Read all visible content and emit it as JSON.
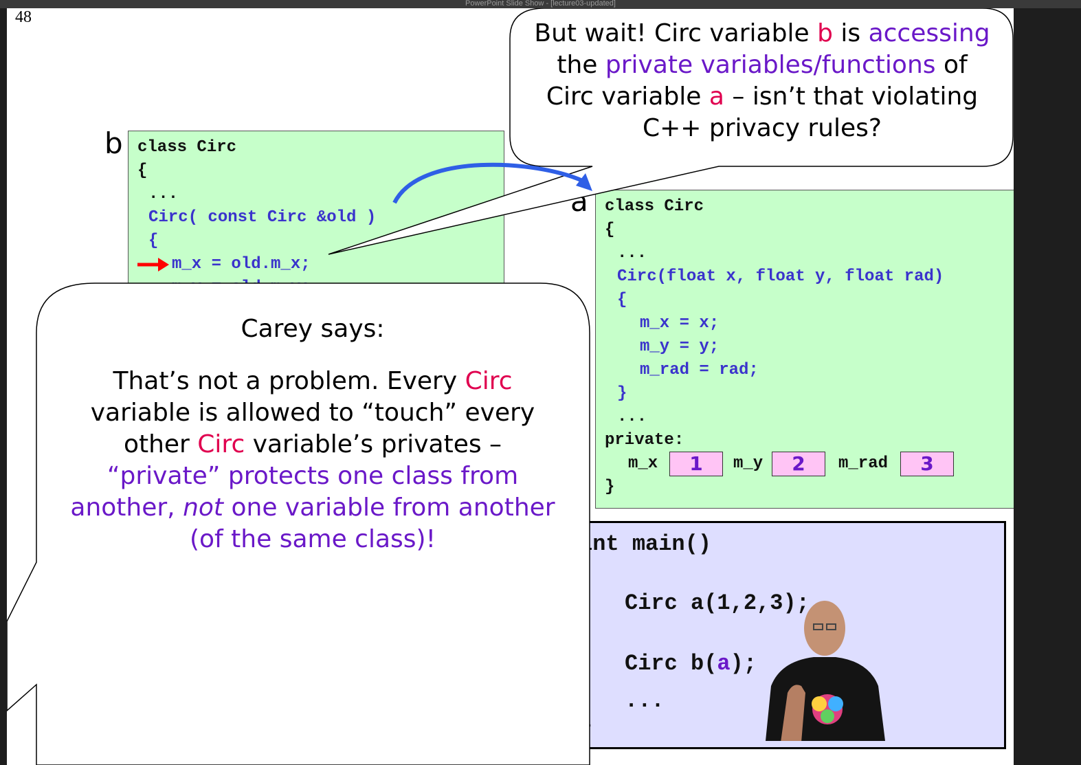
{
  "window": {
    "title": "PowerPoint Slide Show - [lecture03-updated]"
  },
  "slide": {
    "number": "48"
  },
  "top_bubble": {
    "line1_a": "But wait! Circ variable ",
    "line1_b": "b",
    "line1_c": " is ",
    "line1_d": "accessing",
    "line2_a": "the ",
    "line2_b": "private variables/functions",
    "line2_c": " of",
    "line3_a": "Circ variable ",
    "line3_b": "a",
    "line3_c": " – isn’t that violating",
    "line4": "C++ privacy rules?"
  },
  "box_b": {
    "label": "b",
    "lines": [
      "class Circ",
      "{",
      "...",
      "Circ( const Circ &old )",
      "{",
      "m_x = old.m_x;",
      "m_y = old.m_y;"
    ]
  },
  "box_a": {
    "label": "a",
    "lines": [
      "class Circ",
      "{",
      "...",
      "Circ(float x, float y, float rad)",
      "{",
      "m_x = x;",
      "m_y = y;",
      "m_rad = rad;",
      "}",
      "...",
      "private:",
      "}"
    ],
    "private_fields": [
      {
        "name": "m_x",
        "value": "1"
      },
      {
        "name": "m_y",
        "value": "2"
      },
      {
        "name": "m_rad",
        "value": "3"
      }
    ]
  },
  "main_box": {
    "line1": "int main()",
    "line2": "Circ a(1,2,3);",
    "line3_a": "Circ b(",
    "line3_b": "a",
    "line3_c": ");",
    "line4": "...",
    "line5": "}"
  },
  "carey_bubble": {
    "heading": "Carey says:",
    "l1_a": "That’s not a problem.  Every ",
    "l1_b": "Circ",
    "l2": "variable is allowed to “touch” every",
    "l3_a": "other ",
    "l3_b": "Circ",
    "l3_c": " variable’s privates –",
    "l4": "“private” protects one class from",
    "l5_a": "another, ",
    "l5_b": "not",
    "l5_c": " one variable from another",
    "l6": "(of the same class)!"
  },
  "colors": {
    "code_bg": "#c6ffca",
    "main_bg": "#dedeff",
    "value_bg": "#ffc4f5",
    "purple": "#6a18c8",
    "pink": "#e0004f",
    "code_blue": "#3a33cc",
    "arrow_blue": "#2f5fe6",
    "arrow_red": "#ff0000"
  },
  "icons": {
    "pointer": "red-arrow-icon",
    "reference": "curved-blue-arrow-icon"
  }
}
